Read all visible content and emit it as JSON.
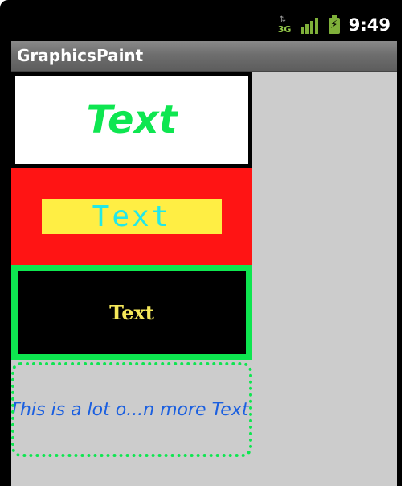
{
  "status_bar": {
    "network_label": "3G",
    "network_icon": "network-3g-icon",
    "signal_icon": "signal-strength-icon",
    "battery_icon": "battery-charging-icon",
    "time": "9:49"
  },
  "app": {
    "title": "GraphicsPaint"
  },
  "panels": [
    {
      "text": "Text",
      "background": "#ffffff",
      "border": "#000000",
      "text_color": "#0ee650"
    },
    {
      "text": "Text",
      "background": "#ffee44",
      "border": "#ff1414",
      "text_color": "#22e8e8"
    },
    {
      "text": "Text",
      "background": "#000000",
      "border": "#0ee650",
      "text_color": "#f5e85a"
    },
    {
      "text": "This is a lot o...n more Text.",
      "background": "#cccccc",
      "border": "#0ee650",
      "text_color": "#1a5fe0"
    }
  ],
  "colors": {
    "content_background": "#cccccc",
    "title_bar": "#6e6e6e",
    "status_bar": "#000000"
  }
}
